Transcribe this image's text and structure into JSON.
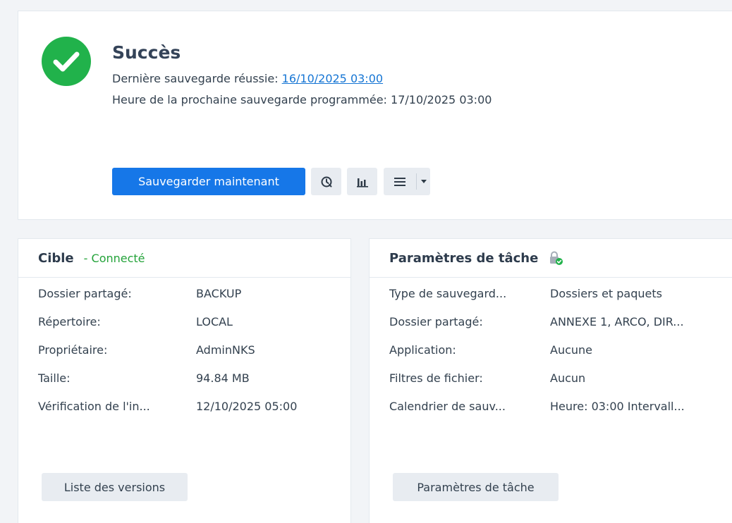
{
  "status": {
    "title": "Succès",
    "last_backup_label": "Dernière sauvegarde réussie:",
    "last_backup_value": "16/10/2025 03:00",
    "next_backup_text": "Heure de la prochaine sauvegarde programmée: 17/10/2025 03:00",
    "icon": "check-circle-icon",
    "color": "#21b24b"
  },
  "toolbar": {
    "backup_now_label": "Sauvegarder maintenant",
    "icons": [
      "history-icon",
      "bar-chart-icon",
      "menu-icon",
      "caret-down-icon"
    ],
    "primary_color": "#1677e8"
  },
  "target_card": {
    "title": "Cible",
    "status": "- Connecté",
    "status_color": "#24a33a",
    "rows": [
      {
        "label": "Dossier partagé:",
        "value": "BACKUP"
      },
      {
        "label": "Répertoire:",
        "value": "LOCAL"
      },
      {
        "label": "Propriétaire:",
        "value": "AdminNKS"
      },
      {
        "label": "Taille:",
        "value": "94.84 MB"
      },
      {
        "label": "Vérification de l'in...",
        "value": "12/10/2025 05:00"
      }
    ],
    "button_label": "Liste des versions"
  },
  "params_card": {
    "title": "Paramètres de tâche",
    "icon": "lock-check-icon",
    "rows": [
      {
        "label": "Type de sauvegard...",
        "value": "Dossiers et paquets"
      },
      {
        "label": "Dossier partagé:",
        "value": "ANNEXE 1, ARCO, DIR..."
      },
      {
        "label": "Application:",
        "value": "Aucune"
      },
      {
        "label": "Filtres de fichier:",
        "value": "Aucun"
      },
      {
        "label": "Calendrier de sauv...",
        "value": "Heure: 03:00 Intervall..."
      }
    ],
    "button_label": "Paramètres de tâche"
  }
}
